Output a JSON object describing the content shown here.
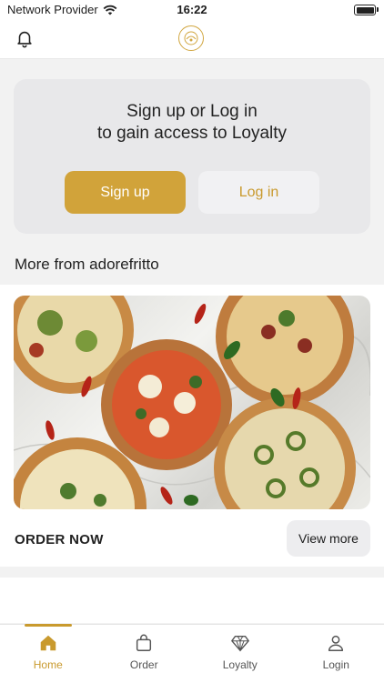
{
  "status_bar": {
    "carrier": "Network Provider",
    "time": "16:22"
  },
  "header": {
    "bell_icon": "bell-icon",
    "logo": "adorefritto-logo"
  },
  "auth_card": {
    "message_line1": "Sign up or Log in",
    "message_line2": "to gain access to Loyalty",
    "signup_label": "Sign up",
    "login_label": "Log in"
  },
  "section": {
    "title": "More from adorefritto"
  },
  "promo": {
    "cta": "ORDER NOW",
    "view_more_label": "View more"
  },
  "tab_bar": {
    "tabs": [
      {
        "label": "Home",
        "icon": "home-icon",
        "active": true
      },
      {
        "label": "Order",
        "icon": "shopping-bag-icon",
        "active": false
      },
      {
        "label": "Loyalty",
        "icon": "diamond-icon",
        "active": false
      },
      {
        "label": "Login",
        "icon": "user-icon",
        "active": false
      }
    ]
  },
  "colors": {
    "accent": "#d1a33a",
    "accent_text": "#c99a2e",
    "background": "#f2f2f2"
  }
}
